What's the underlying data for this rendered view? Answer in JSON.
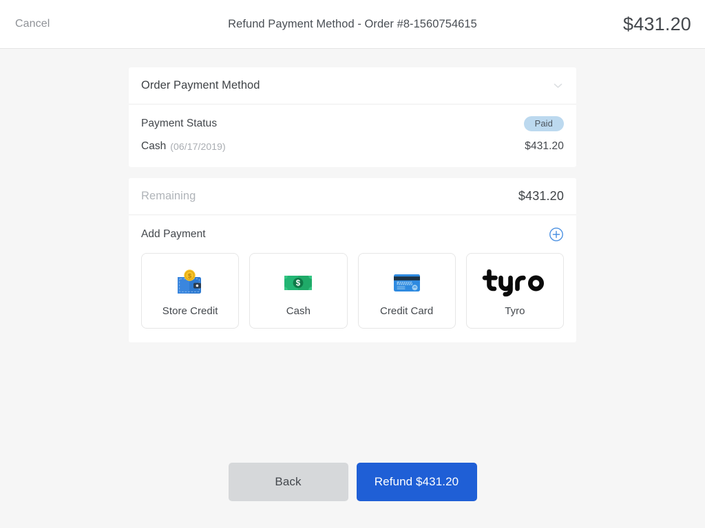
{
  "topbar": {
    "cancel_label": "Cancel",
    "title": "Refund Payment Method - Order #8-1560754615",
    "amount": "$431.20"
  },
  "order_payment_card": {
    "header_title": "Order Payment Method",
    "collapse_icon": "chevron-down-icon",
    "payment_status_label": "Payment Status",
    "payment_status_badge": "Paid",
    "method_name": "Cash",
    "method_date": "(06/17/2019)",
    "method_amount": "$431.20"
  },
  "add_payment_card": {
    "remaining_label": "Remaining",
    "remaining_amount": "$431.20",
    "add_payment_label": "Add Payment",
    "add_icon": "plus-circle-icon",
    "methods": [
      {
        "label": "Store Credit",
        "icon": "wallet-icon"
      },
      {
        "label": "Cash",
        "icon": "banknote-icon"
      },
      {
        "label": "Credit Card",
        "icon": "credit-card-icon"
      },
      {
        "label": "Tyro",
        "icon": "tyro-logo"
      }
    ]
  },
  "footer": {
    "back_label": "Back",
    "refund_label": "Refund $431.20"
  },
  "colors": {
    "page_background": "#f6f6f6",
    "card_background": "#ffffff",
    "primary_blue": "#1f5fd6",
    "badge_blue": "#bcd9ef",
    "back_gray": "#d6d8da",
    "accent_icon_blue": "#4a90e2",
    "cash_green": "#22b573",
    "wallet_blue": "#2e7ad1",
    "coin_gold": "#f7c325"
  }
}
